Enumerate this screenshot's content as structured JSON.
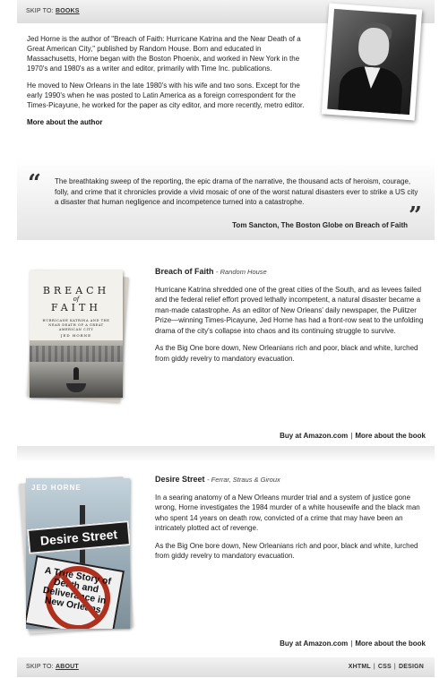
{
  "header": {
    "skip_prefix": "SKIP TO:",
    "skip_target": "BOOKS"
  },
  "author": {
    "paragraphs": [
      "Jed Horne is the author of \"Breach of Faith: Hurricane Katrina and the Near Death of a Great American City,\" published by Random House. Born and educated in Massachusetts, Horne began with the Boston Phoenix, and worked in New York in the 1970's and 1980's as a writer and editor, primarily with Time Inc. publications.",
      "He moved to New Orleans in the late 1980's with his wife and two sons. Except for the early 1990's when he was posted to Latin America as a foreign correspondent for the Times-Picayune, he worked for the paper as city editor, and more recently, metro editor."
    ],
    "more_link": "More about the author"
  },
  "quote": {
    "open_mark": "“",
    "close_mark": "”",
    "text": "The breathtaking sweep of the reporting, the epic drama of the narrative, the thousand acts of heroism, courage, folly, and crime that it chronicles provide a vivid mosaic of one of the worst natural disasters ever to strike a US city a disaster that human negligence and incompetence turned into a catastrophe.",
    "source": "Tom Sancton, The Boston Globe on Breach of Faith"
  },
  "books": [
    {
      "title": "Breach of Faith",
      "publisher": "- Random House",
      "paragraphs": [
        "Hurricane Katrina shredded one of the great cities of the South, and as levees failed and the federal relief effort proved lethally incompetent, a natural disaster became a man-made catastrophe. As an editor of New Orleans' daily newspaper, the Pulitzer Prize—winning Times-Picayune, Jed Horne has had a front-row seat to the unfolding drama of the city's collapse into chaos and its continuing struggle to survive.",
        "As the Big One bore down, New Orleanians rich and poor, black and white, lurched from giddy revelry to mandatory evacuation."
      ],
      "buy_link": "Buy at Amazon.com",
      "separator": "|",
      "more_link": "More about the book",
      "cover": {
        "title_top": "BREACH",
        "title_mid": "of",
        "title_bottom": "FAITH",
        "subtitle": "HURRICANE KATRINA AND THE NEAR DEATH OF A GREAT AMERICAN CITY",
        "author": "JED HORNE"
      }
    },
    {
      "title": "Desire Street",
      "publisher": "- Ferrar, Straus & Giroux",
      "paragraphs": [
        "In a searing anatomy of a New Orleans murder trial and a system of justice gone wrong, Horne investigates the 1984 murder of a white housewife and the black man who spent 14 years on death row, convicted of a crime that may have been an intricately plotted act of revenge.",
        "As the Big One bore down, New Orleanians rich and poor, black and white, lurched from giddy revelry to mandatory evacuation."
      ],
      "buy_link": "Buy at Amazon.com",
      "separator": "|",
      "more_link": "More about the book",
      "cover": {
        "author": "JED HORNE",
        "sign": "Desire Street",
        "subtitle": "A True Story of Death and Deliverance in New Orleans"
      }
    }
  ],
  "footer": {
    "skip_prefix": "SKIP TO:",
    "skip_target": "ABOUT",
    "links": [
      "XHTML",
      "CSS",
      "DESIGN"
    ],
    "separator": "|"
  }
}
